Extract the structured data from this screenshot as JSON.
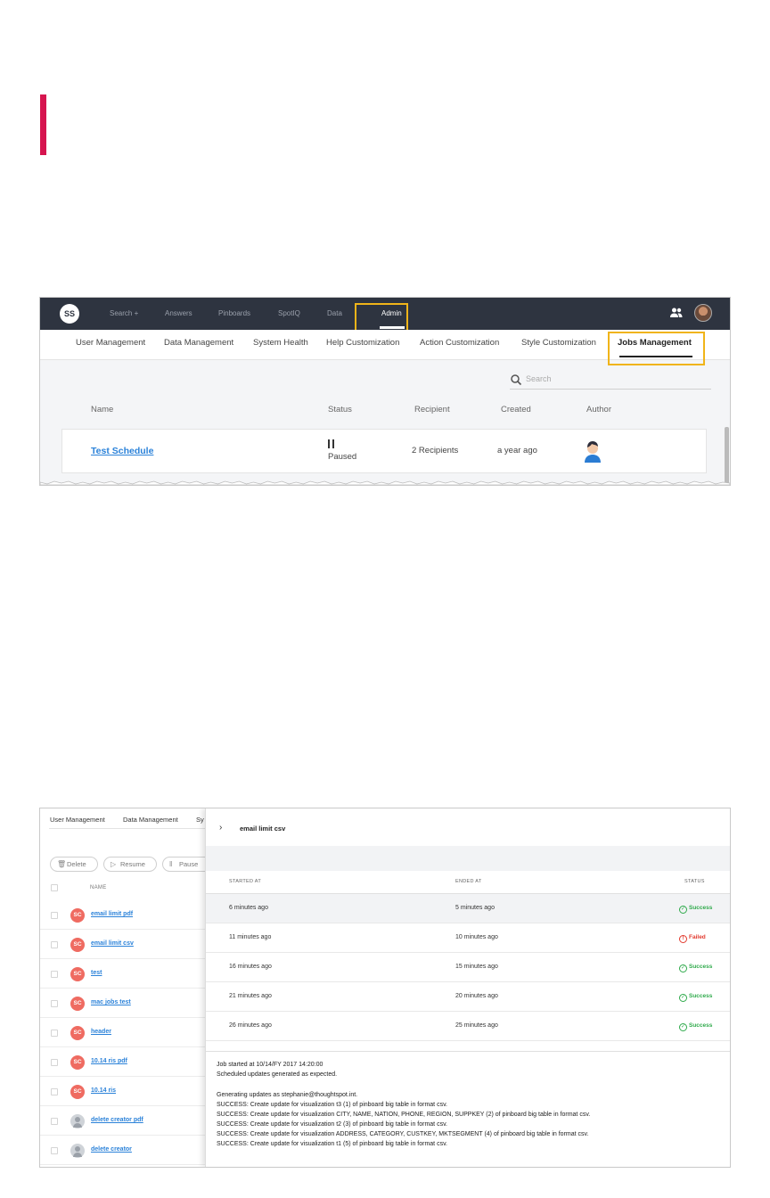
{
  "colors": {
    "accent_bar": "#d6154f",
    "highlight": "#f0b419",
    "topnav_bg": "#2e3440",
    "link": "#2b82d9",
    "success": "#2faa4b",
    "failed": "#e23a2e",
    "badge": "#ef6b61"
  },
  "top": {
    "logo": "SS",
    "nav": [
      {
        "label": "Search +"
      },
      {
        "label": "Answers"
      },
      {
        "label": "Pinboards"
      },
      {
        "label": "SpotIQ"
      },
      {
        "label": "Data"
      },
      {
        "label": "Admin"
      }
    ],
    "icons": {
      "people": "people-icon",
      "avatar": "user-avatar"
    }
  },
  "subnav": [
    "User Management",
    "Data Management",
    "System Health",
    "Help Customization",
    "Action Customization",
    "Style Customization",
    "Jobs Management"
  ],
  "search": {
    "placeholder": "Search"
  },
  "table1": {
    "headers": [
      "Name",
      "Status",
      "Recipient",
      "Created",
      "Author"
    ],
    "row": {
      "name": "Test Schedule",
      "status": "Paused",
      "recipient": "2 Recipients",
      "created": "a year ago"
    }
  },
  "shot2": {
    "subnav": [
      "User Management",
      "Data Management",
      "Sy"
    ],
    "toolbar": {
      "delete": "Delete",
      "resume": "Resume",
      "pause": "Pause"
    },
    "list_header": "NAME",
    "list": [
      {
        "badge": "SC",
        "name": "email limit pdf"
      },
      {
        "badge": "SC",
        "name": "email limit csv"
      },
      {
        "badge": "SC",
        "name": "test"
      },
      {
        "badge": "SC",
        "name": "mac jobs test"
      },
      {
        "badge": "SC",
        "name": "header"
      },
      {
        "badge": "SC",
        "name": "10.14 ris pdf"
      },
      {
        "badge": "SC",
        "name": "10.14 ris"
      },
      {
        "badge": "",
        "name": "delete creator pdf"
      },
      {
        "badge": "",
        "name": "delete creator"
      }
    ],
    "detail": {
      "title": "email limit csv",
      "headers": {
        "started": "STARTED AT",
        "ended": "ENDED AT",
        "status": "STATUS"
      },
      "runs": [
        {
          "started": "6 minutes ago",
          "ended": "5 minutes ago",
          "status": "Success"
        },
        {
          "started": "11 minutes ago",
          "ended": "10 minutes ago",
          "status": "Failed"
        },
        {
          "started": "16 minutes ago",
          "ended": "15 minutes ago",
          "status": "Success"
        },
        {
          "started": "21 minutes ago",
          "ended": "20 minutes ago",
          "status": "Success"
        },
        {
          "started": "26 minutes ago",
          "ended": "25 minutes ago",
          "status": "Success"
        }
      ],
      "log": [
        "Job started at 10/14/FY 2017 14:20:00",
        "Scheduled updates generated as expected.",
        "Generating updates as stephanie@thoughtspot.int.",
        "SUCCESS: Create update for visualization t3 (1) of pinboard big table in format csv.",
        "SUCCESS: Create update for visualization CITY, NAME, NATION, PHONE, REGION, SUPPKEY (2) of pinboard big table in format csv.",
        "SUCCESS: Create update for visualization t2 (3) of pinboard big table in format csv.",
        "SUCCESS: Create update for visualization ADDRESS, CATEGORY, CUSTKEY, MKTSEGMENT (4) of pinboard big table in format csv.",
        "SUCCESS: Create update for visualization t1 (5) of pinboard big table in format csv."
      ]
    }
  }
}
